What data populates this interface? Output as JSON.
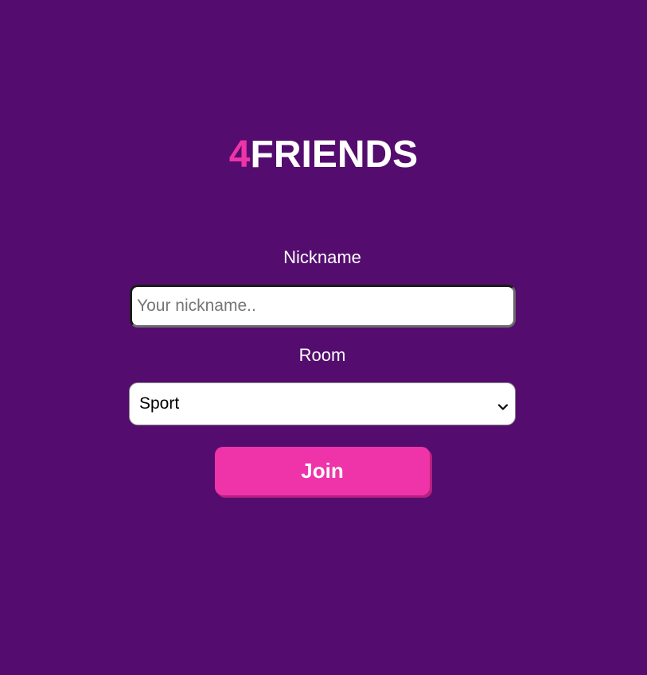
{
  "logo": {
    "accent": "4",
    "text": "FRIENDS"
  },
  "form": {
    "nickname_label": "Nickname",
    "nickname_placeholder": "Your nickname..",
    "nickname_value": "",
    "room_label": "Room",
    "room_selected": "Sport",
    "join_label": "Join"
  },
  "icons": {
    "select_arrow": "chevron-down-icon"
  },
  "colors": {
    "background": "#540d6e",
    "accent": "#ee34a8",
    "text": "#ffffff"
  }
}
